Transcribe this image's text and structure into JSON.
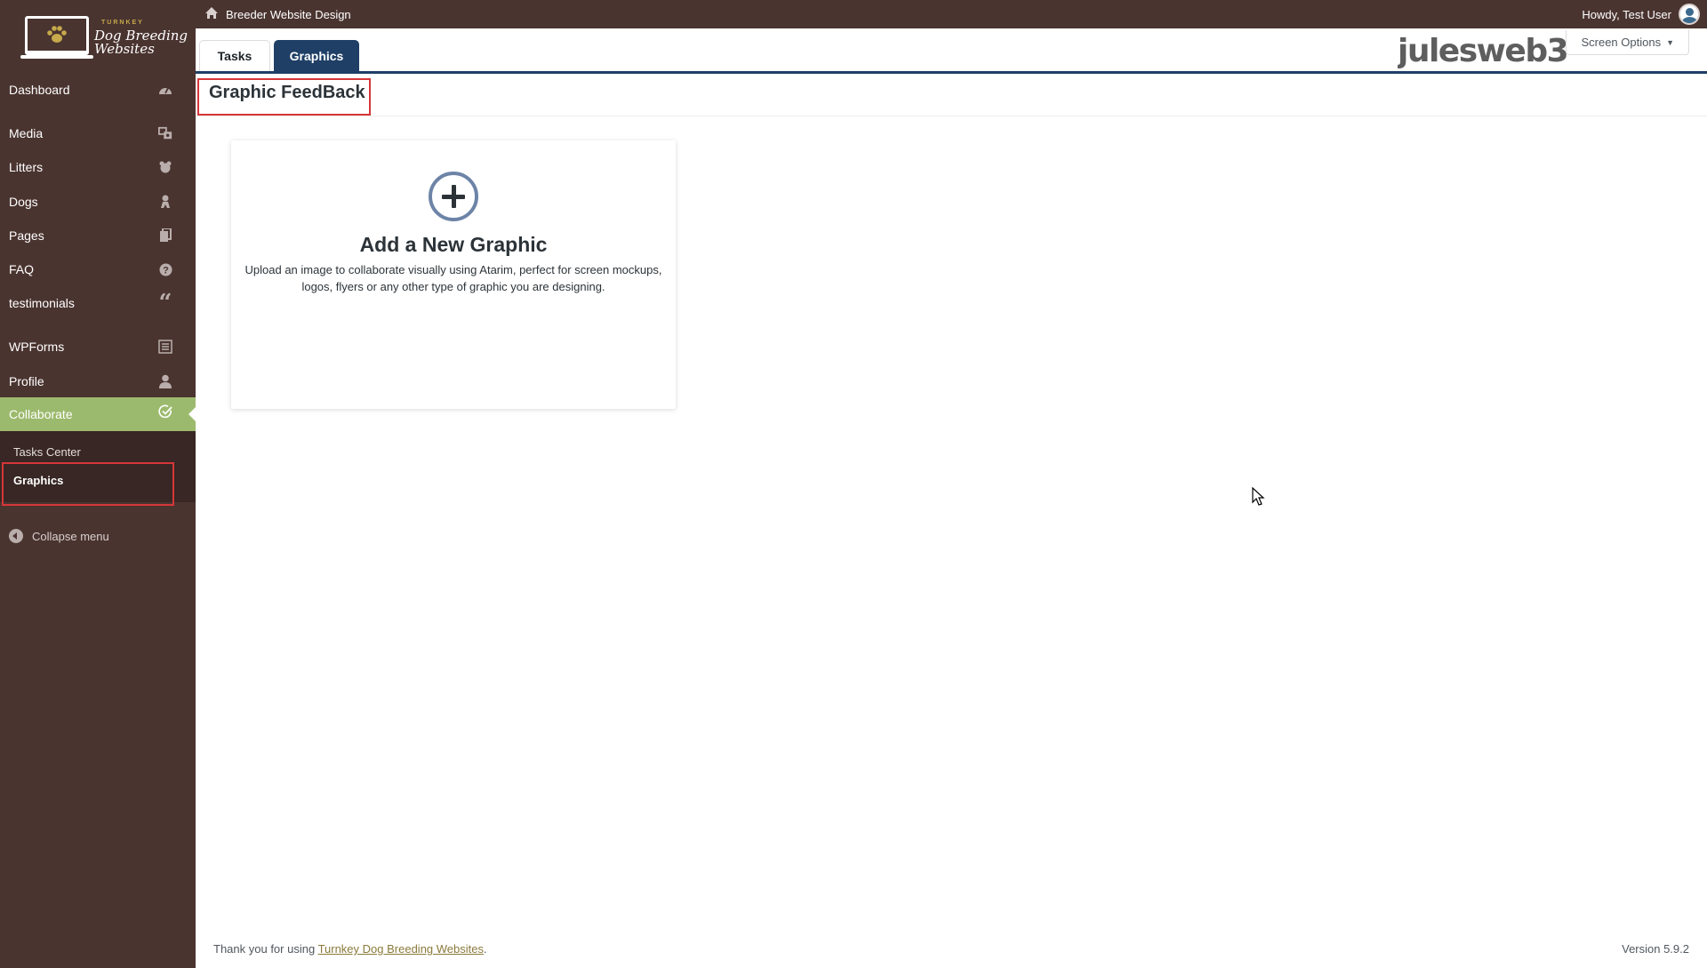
{
  "brand": {
    "logo_small": "TURNKEY",
    "logo_line1": "Dog Breeding",
    "logo_line2": "Websites"
  },
  "adminbar": {
    "site_name": "Breeder Website Design",
    "howdy": "Howdy, Test User"
  },
  "sidebar": {
    "items": [
      {
        "label": "Dashboard",
        "icon": "dashboard-icon"
      },
      {
        "label": "Media",
        "icon": "media-icon"
      },
      {
        "label": "Litters",
        "icon": "paw-icon"
      },
      {
        "label": "Dogs",
        "icon": "dog-icon"
      },
      {
        "label": "Pages",
        "icon": "pages-icon"
      },
      {
        "label": "FAQ",
        "icon": "help-icon"
      },
      {
        "label": "testimonials",
        "icon": "quote-icon"
      },
      {
        "label": "WPForms",
        "icon": "forms-icon"
      },
      {
        "label": "Profile",
        "icon": "user-icon"
      },
      {
        "label": "Collaborate",
        "icon": "check-circle-icon"
      }
    ],
    "submenu": [
      "Tasks Center",
      "Graphics"
    ],
    "collapse_label": "Collapse menu"
  },
  "tabs": [
    {
      "label": "Tasks",
      "active": false
    },
    {
      "label": "Graphics",
      "active": true
    }
  ],
  "header": {
    "brand_logo_text": "julesweb3",
    "screen_options": "Screen Options"
  },
  "page": {
    "title": "Graphic FeedBack"
  },
  "card": {
    "title": "Add a New Graphic",
    "description_line1": "Upload an image to collaborate visually using Atarim, perfect for screen mockups,",
    "description_line2": "logos, flyers or any other type of graphic you are designing."
  },
  "footer": {
    "thanks_prefix": "Thank you for using ",
    "thanks_link": "Turnkey Dog Breeding Websites",
    "thanks_suffix": ".",
    "version": "Version 5.9.2"
  },
  "colors": {
    "sidebar_bg": "#4a3430",
    "active_menu": "#9cba6d",
    "tab_active": "#1f3f66",
    "highlight_box": "#d63638"
  }
}
